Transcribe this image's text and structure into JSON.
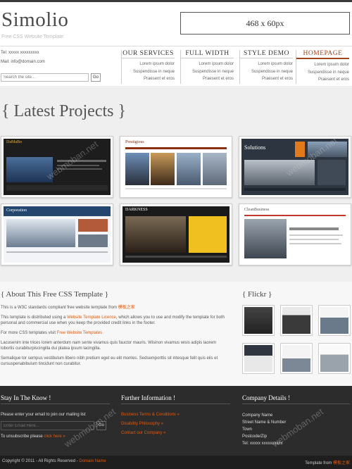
{
  "header": {
    "logo": "Simolio",
    "tagline": "Free CSS Website Template",
    "ad_label": "468 x 60px",
    "tel": "Tel: xxxxx xxxxxxxxx",
    "mail": "Mail: info@domain.com",
    "search_placeholder": "Search the site...",
    "search_button": "Go"
  },
  "nav": [
    {
      "title": "OUR SERVICES",
      "subs": [
        "Lorem ipsum dolor",
        "Suspendisse in neque",
        "Praesent et eros"
      ]
    },
    {
      "title": "FULL WIDTH",
      "subs": [
        "Lorem ipsum dolor",
        "Suspendisse in neque",
        "Praesent et eros"
      ]
    },
    {
      "title": "STYLE DEMO",
      "subs": [
        "Lorem ipsum dolor",
        "Suspendisse in neque",
        "Praesent et eros"
      ]
    },
    {
      "title": "HOMEPAGE",
      "subs": [
        "Lorem ipsum dolor",
        "Suspendisse in neque",
        "Praesent et eros"
      ]
    }
  ],
  "projects": {
    "title": "{ Latest Projects }",
    "items": [
      {
        "name": "DaMaBo"
      },
      {
        "name": "Prestigious"
      },
      {
        "name": "Solutions"
      },
      {
        "name": "Corporation"
      },
      {
        "name": "DARKNESS"
      },
      {
        "name": "CleanBusiness"
      }
    ]
  },
  "about": {
    "title": "{ About This Free CSS Template }",
    "p1": "This is a W3C standards compliant free website template from",
    "p1_link": "模板之家",
    "p2a": "This template is distributed using a",
    "p2_link": "Website Template Licence",
    "p2b": ", which allows you to use and modify the template for both personal and commercial use when you keep the provided credit links in the footer.",
    "p3a": "For more CSS templates visit",
    "p3_link": "Free Website Templates",
    "p4": "Lacusenim inte trices lorem anterdum nam sente vivamus quis fauctor mauris. Wisinon vivamus wisis adipis laorem lobortis curabiturpiscingilla dui platea ipsum lacingilla.",
    "p5": "Semalique tor sempus vestibulum libero nibh pretium eget eu elit montes. Sedsemporttis sit intesque felit quis elis et cursuspenabibulum tincidunt non curabitur."
  },
  "flickr": {
    "title": "{ Flickr }"
  },
  "footer": {
    "col1": {
      "title": "Stay In The Know !",
      "text": "Please enter your email to join our mailing list",
      "email_placeholder": "Enter Email Here...",
      "go": "Go",
      "unsub": "To unsubscribe please",
      "unsub_link": "click here »"
    },
    "col2": {
      "title": "Further Information !",
      "links": [
        "Business Terms & Conditions »",
        "Disability Philosophy »",
        "Contact our Company »"
      ]
    },
    "col3": {
      "title": "Company Details !",
      "lines": [
        "Company Name",
        "Street Name & Number",
        "Town",
        "Postcode/Zip",
        "Tel: xxxxx xxxxxxxxxx"
      ]
    },
    "copyright": "Copyright © 2011 - All Rights Reserved -",
    "copyright_link": "Domain Name",
    "template_from": "Template from",
    "template_link": "模板之家"
  },
  "watermark": "webmoban.net",
  "colors": {
    "accent": "#e2590c",
    "dark": "#2c2c2c",
    "nav_active": "#a0441a"
  }
}
